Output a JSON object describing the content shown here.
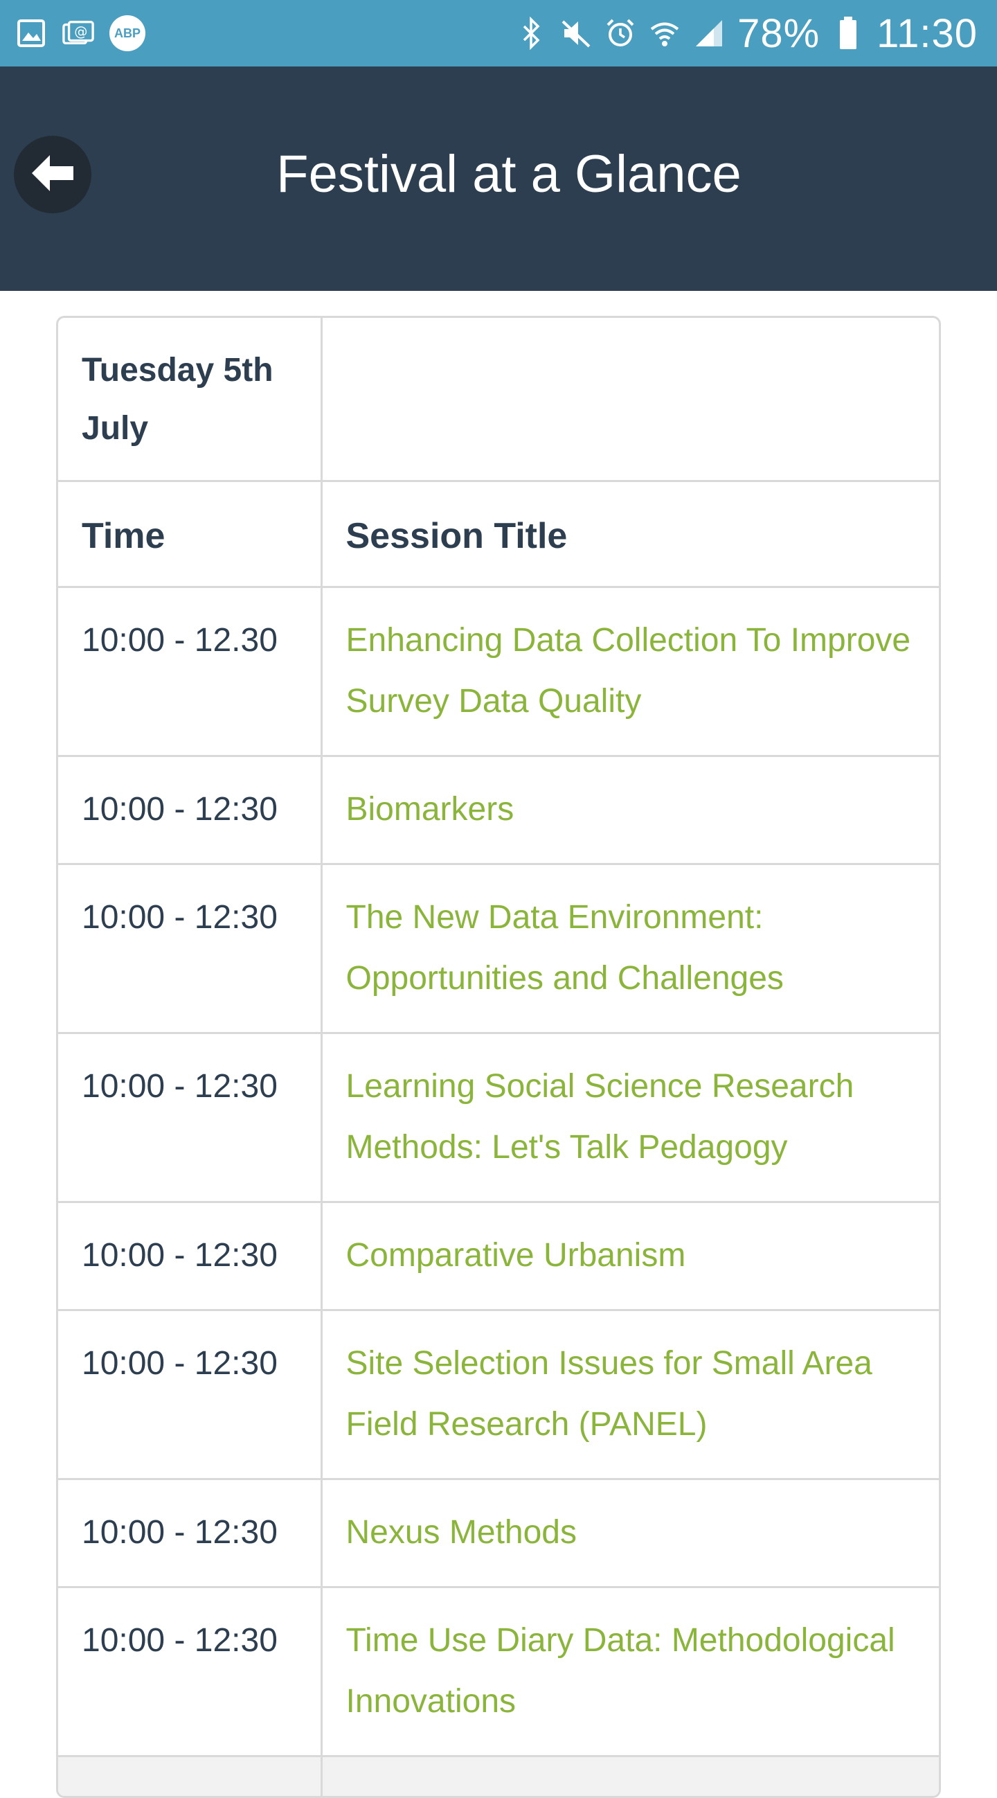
{
  "status_bar": {
    "left_icons": [
      "gallery-icon",
      "email-icon",
      "adblock-icon"
    ],
    "abp_text": "ABP",
    "right_icons": [
      "bluetooth-icon",
      "mute-icon",
      "alarm-icon",
      "wifi-icon",
      "signal-icon",
      "battery-icon"
    ],
    "battery": "78%",
    "time": "11:30"
  },
  "header": {
    "title": "Festival at a Glance",
    "back_icon": "arrow-left-icon"
  },
  "colors": {
    "status_bar": "#4a9fc1",
    "header": "#2c3e50",
    "link": "#8ab43a",
    "text": "#2c3e50",
    "border": "#d9d9d9"
  },
  "schedule": {
    "day": "Tuesday 5th July",
    "columns": {
      "time": "Time",
      "title": "Session Title"
    },
    "rows": [
      {
        "time": "10:00 - 12.30",
        "title": "Enhancing Data Collection To Improve Survey Data Quality"
      },
      {
        "time": "10:00 - 12:30",
        "title": "Biomarkers"
      },
      {
        "time": "10:00 - 12:30",
        "title": "The New Data Environment: Opportunities and Challenges"
      },
      {
        "time": "10:00 - 12:30",
        "title": "Learning Social Science Research Methods: Let's Talk Pedagogy"
      },
      {
        "time": "10:00 - 12:30",
        "title": "Comparative Urbanism"
      },
      {
        "time": "10:00 - 12:30",
        "title": "Site Selection Issues for Small Area Field Research (PANEL)"
      },
      {
        "time": "10:00 - 12:30",
        "title": "Nexus Methods"
      },
      {
        "time": "10:00 - 12:30",
        "title": "Time Use Diary Data: Methodological Innovations"
      }
    ]
  }
}
